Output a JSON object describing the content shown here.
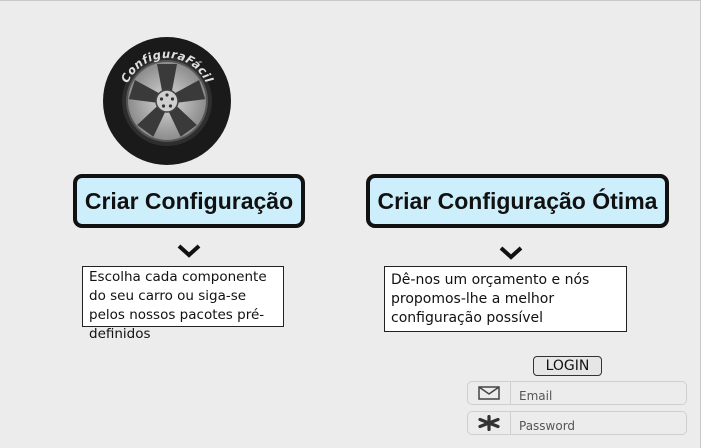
{
  "logo": {
    "text": "ConfiguraFácil"
  },
  "options": [
    {
      "label": "Criar Configuração",
      "description": "Escolha cada componente do seu carro ou siga-se pelos nossos pacotes pré-definidos"
    },
    {
      "label": "Criar Configuração Ótima",
      "description": "Dê-nos um orçamento e nós propomos-lhe a melhor configuração possível"
    }
  ],
  "login": {
    "button_label": "LOGIN",
    "email_placeholder": "Email",
    "password_placeholder": "Password"
  },
  "icons": {
    "expand": "chevron-down-icon",
    "email": "mail-icon",
    "password": "asterisk-icon"
  }
}
